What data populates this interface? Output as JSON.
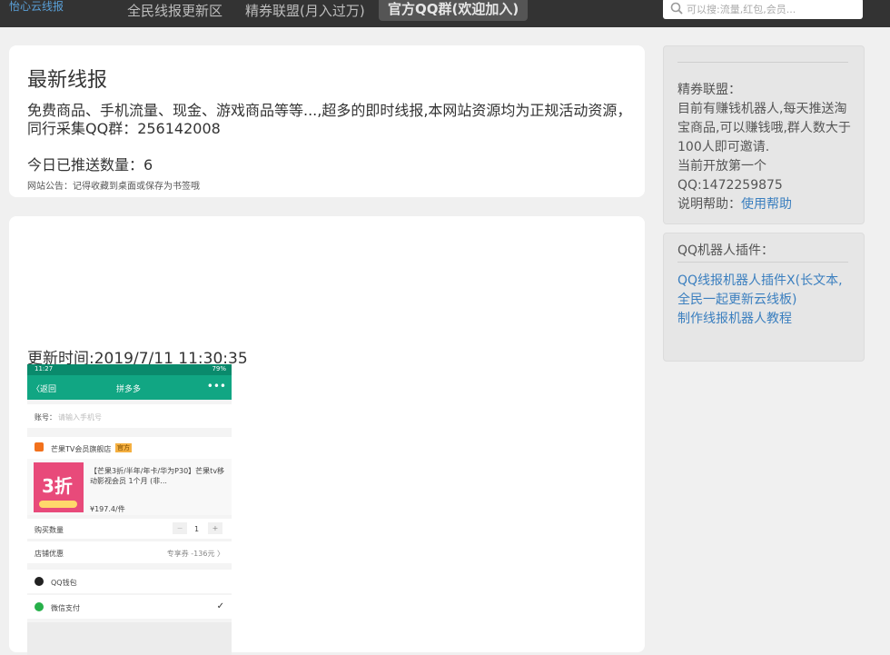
{
  "nav": {
    "brand": "怡心云线报",
    "items": [
      "全民线报更新区",
      "精券联盟(月入过万)",
      "官方QQ群(欢迎加入)"
    ],
    "search_placeholder": "可以搜:流量,红包,会员..."
  },
  "main": {
    "title": "最新线报",
    "description": "免费商品、手机流量、现金、游戏商品等等...,超多的即时线报,本网站资源均为正规活动资源，同行采集QQ群：256142008",
    "push_count": "今日已推送数量：6",
    "notice": "网站公告：记得收藏到桌面或保存为书签哦",
    "updated": "更新时间:2019/7/11 11:30:35"
  },
  "screenshot": {
    "status_time": "11:27",
    "status_right": "79%",
    "back": "〈返回",
    "title": "拼多多",
    "more": "•••",
    "account_label": "账号：",
    "account_placeholder": "请输入手机号",
    "shop_name": "芒果TV会员旗舰店",
    "shop_tag": "官方",
    "product_badge": "3折",
    "product_title": "【芒果3折/半年/年卡/华为P30】芒果tv移动影视会员 1个月 (非...",
    "price": "¥197.4/件",
    "qty_label": "购买数量",
    "qty_minus": "−",
    "qty_value": "1",
    "qty_plus": "+",
    "discount_label": "店铺优惠",
    "discount_value": "专享券 -136元 〉",
    "pay1": "QQ钱包",
    "pay2": "微信支付",
    "pay2_check": "✓"
  },
  "sidebar": {
    "block1": {
      "l1": "精券联盟：",
      "l2": "目前有赚钱机器人,每天推送淘宝商品,可以赚钱哦,群人数大于100人即可邀请.",
      "l3": "当前开放第一个",
      "l4": "QQ:1472259875",
      "help_prefix": "说明帮助：",
      "help_link": "使用帮助"
    },
    "block2": {
      "title": "QQ机器人插件：",
      "link1": "QQ线报机器人插件X(长文本,全民一起更新云线板)",
      "link2": "制作线报机器人教程"
    }
  }
}
